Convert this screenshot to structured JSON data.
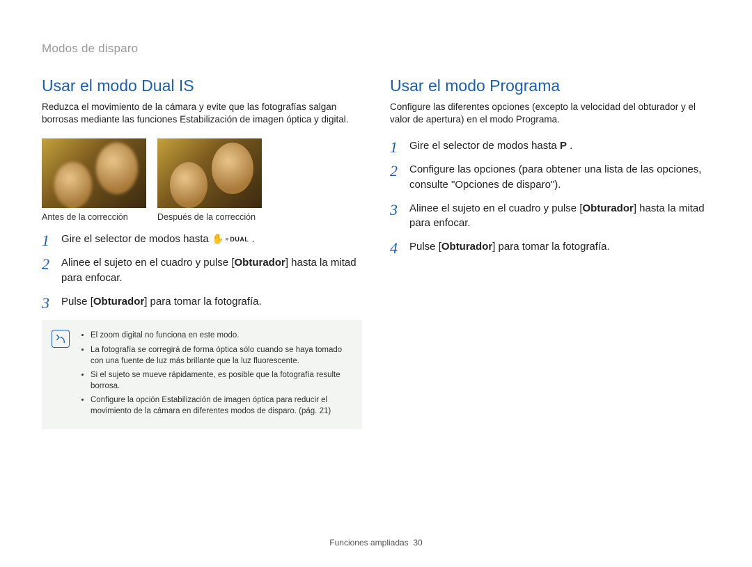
{
  "breadcrumb": "Modos de disparo",
  "left": {
    "heading": "Usar el modo Dual IS",
    "intro": "Reduzca el movimiento de la cámara y evite que las fotografías salgan borrosas mediante las funciones Estabilización de imagen óptica y digital.",
    "photos": {
      "before_caption": "Antes de la corrección",
      "after_caption": "Después de la corrección"
    },
    "steps": [
      {
        "pre": "Gire el selector de modos hasta ",
        "icon": "dual",
        "post": " ."
      },
      {
        "pre": "Alinee el sujeto en el cuadro y pulse [",
        "bold": "Obturador",
        "post": "] hasta la mitad para enfocar."
      },
      {
        "pre": "Pulse [",
        "bold": "Obturador",
        "post": "] para tomar la fotografía."
      }
    ],
    "notes": [
      "El zoom digital no funciona en este modo.",
      "La fotografía se corregirá de forma óptica sólo cuando se haya tomado con una fuente de luz más brillante que la luz fluorescente.",
      "Si el sujeto se mueve rápidamente, es posible que la fotografía resulte borrosa.",
      "Configure la opción Estabilización de imagen óptica para reducir el movimiento de la cámara en diferentes modos de disparo. (pág. 21)"
    ]
  },
  "right": {
    "heading": "Usar el modo Programa",
    "intro": "Configure las diferentes opciones (excepto la velocidad del obturador y el valor de apertura) en el modo Programa.",
    "steps": [
      {
        "pre": "Gire el selector de modos hasta ",
        "icon": "P",
        "post": " ."
      },
      {
        "pre": "Configure las opciones (para obtener una lista de las opciones, consulte \"Opciones de disparo\")."
      },
      {
        "pre": "Alinee el sujeto en el cuadro y pulse [",
        "bold": "Obturador",
        "post": "] hasta la mitad para enfocar."
      },
      {
        "pre": "Pulse [",
        "bold": "Obturador",
        "post": "] para tomar la fotografía."
      }
    ]
  },
  "footer": {
    "label": "Funciones ampliadas",
    "page": "30"
  },
  "icons": {
    "dual_text": "DUAL"
  }
}
